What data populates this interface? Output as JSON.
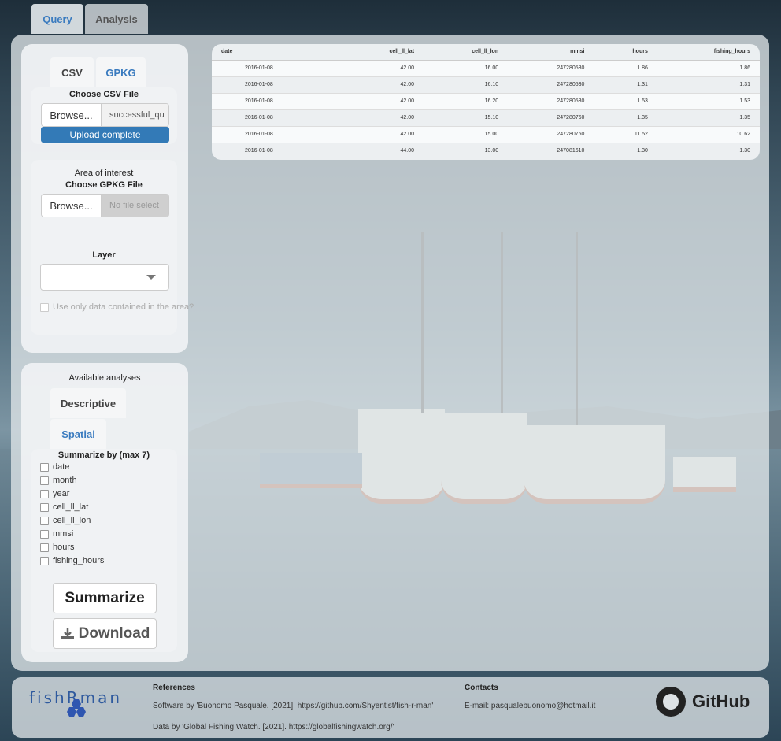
{
  "nav": {
    "tabs": [
      "Query",
      "Analysis"
    ]
  },
  "input_card": {
    "tabs": [
      "CSV",
      "GPKG"
    ],
    "csv_label": "Choose CSV File",
    "browse_label": "Browse...",
    "csv_filename": "successful_qu",
    "upload_status": "Upload complete",
    "progress": 1.0
  },
  "aoi_card": {
    "title": "Area of interest",
    "gpkg_label": "Choose GPKG File",
    "browse_label": "Browse...",
    "gpkg_placeholder": "No file select",
    "layer_label": "Layer",
    "layer_value": "",
    "area_checkbox": "Use only data contained in the area?"
  },
  "analysis_card": {
    "title": "Available analyses",
    "tabs": [
      "Descriptive",
      "Spatial"
    ],
    "summarize_label": "Summarize by (max 7)",
    "fields": [
      "date",
      "month",
      "year",
      "cell_ll_lat",
      "cell_ll_lon",
      "mmsi",
      "hours",
      "fishing_hours"
    ],
    "summarize_button": "Summarize",
    "download_button": "Download"
  },
  "table": {
    "columns": [
      "date",
      "cell_ll_lat",
      "cell_ll_lon",
      "mmsi",
      "hours",
      "fishing_hours"
    ],
    "rows": [
      [
        "2016-01-08",
        "42.00",
        "16.00",
        "247280530",
        "1.86",
        "1.86"
      ],
      [
        "2016-01-08",
        "42.00",
        "16.10",
        "247280530",
        "1.31",
        "1.31"
      ],
      [
        "2016-01-08",
        "42.00",
        "16.20",
        "247280530",
        "1.53",
        "1.53"
      ],
      [
        "2016-01-08",
        "42.00",
        "15.10",
        "247280760",
        "1.35",
        "1.35"
      ],
      [
        "2016-01-08",
        "42.00",
        "15.00",
        "247280760",
        "11.52",
        "10.62"
      ],
      [
        "2016-01-08",
        "44.00",
        "13.00",
        "247081610",
        "1.30",
        "1.30"
      ]
    ]
  },
  "footer": {
    "logo": "fishRman",
    "references_title": "References",
    "reference_1": "Software by 'Buonomo Pasquale. [2021]. https://github.com/Shyentist/fish-r-man'",
    "reference_2": "Data by 'Global Fishing Watch. [2021]. https://globalfishingwatch.org/'",
    "contacts_title": "Contacts",
    "email": "E-mail: pasqualebuonomo@hotmail.it",
    "github": "GitHub"
  },
  "colors": {
    "accent": "#3a7bbf",
    "progress": "#337ab7"
  }
}
